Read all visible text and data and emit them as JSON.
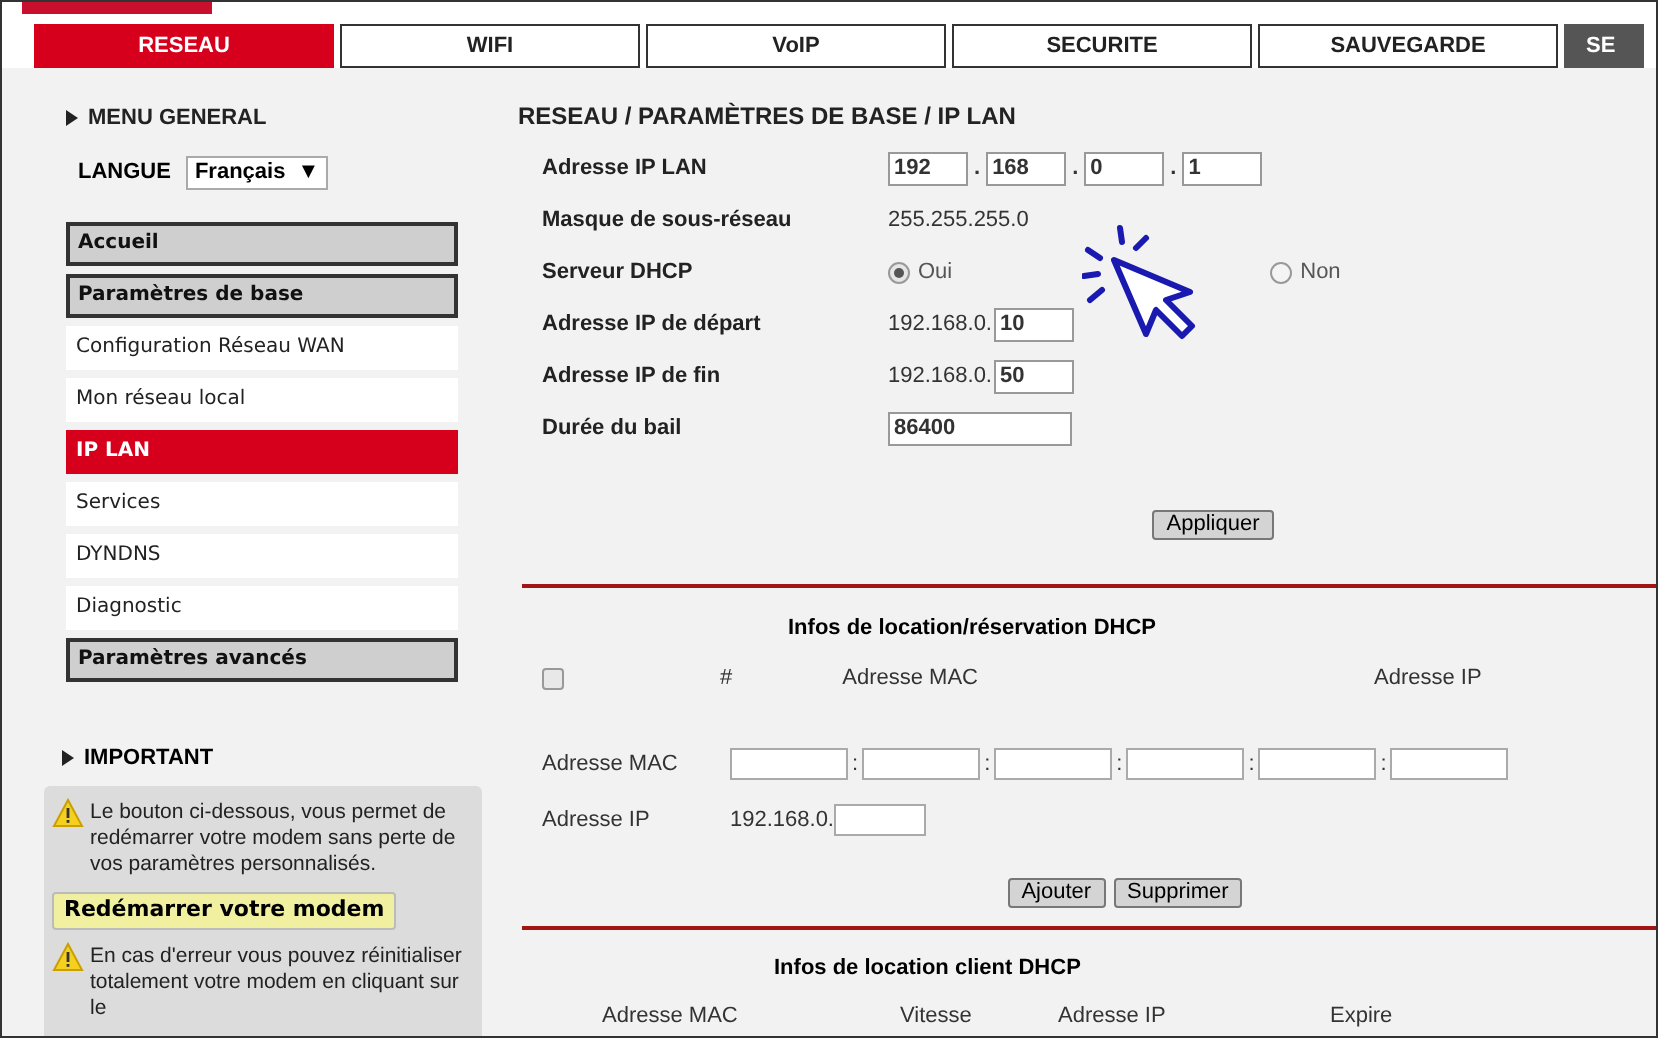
{
  "tabs": [
    {
      "label": "RESEAU",
      "selected": true
    },
    {
      "label": "WIFI",
      "selected": false
    },
    {
      "label": "VoIP",
      "selected": false
    },
    {
      "label": "SECURITE",
      "selected": false
    },
    {
      "label": "SAUVEGARDE",
      "selected": false
    },
    {
      "label": "SE",
      "selected": false
    }
  ],
  "sidebar": {
    "menu_title": "MENU GENERAL",
    "language_label": "LANGUE",
    "language_value": "Français",
    "language_caret": "▼",
    "items": [
      {
        "label": "Accueil",
        "kind": "section",
        "selected": false
      },
      {
        "label": "Paramètres de base",
        "kind": "section",
        "selected": false
      },
      {
        "label": "Configuration Réseau WAN",
        "kind": "link",
        "selected": false
      },
      {
        "label": "Mon réseau local",
        "kind": "link",
        "selected": false
      },
      {
        "label": "IP LAN",
        "kind": "link",
        "selected": true
      },
      {
        "label": "Services",
        "kind": "link",
        "selected": false
      },
      {
        "label": "DYNDNS",
        "kind": "link",
        "selected": false
      },
      {
        "label": "Diagnostic",
        "kind": "link",
        "selected": false
      },
      {
        "label": "Paramètres avancés",
        "kind": "section",
        "selected": false
      }
    ],
    "important_title": "IMPORTANT",
    "notices": [
      {
        "text": "Le bouton ci-dessous, vous permet de redémarrer votre modem sans perte de vos paramètres personnalisés.",
        "button": "Redémarrer votre modem"
      },
      {
        "text": "En cas d'erreur vous pouvez réinitialiser totalement votre modem en cliquant sur le"
      }
    ]
  },
  "content": {
    "breadcrumb": "RESEAU / PARAMÈTRES DE BASE / IP LAN",
    "fields": [
      {
        "label": "Adresse IP LAN",
        "kind": "ip4",
        "separator": ".",
        "values": [
          "192",
          "168",
          "0",
          "1"
        ]
      },
      {
        "label": "Masque de sous-réseau",
        "kind": "text",
        "value": "255.255.255.0"
      },
      {
        "label": "Serveur DHCP",
        "kind": "radio",
        "options": [
          {
            "label": "Oui",
            "selected": true
          },
          {
            "label": "Non",
            "selected": false
          }
        ]
      },
      {
        "label": "Adresse IP de départ",
        "kind": "prefixed",
        "prefix": "192.168.0.",
        "value": "10"
      },
      {
        "label": "Adresse IP de fin",
        "kind": "prefixed",
        "prefix": "192.168.0.",
        "value": "50"
      },
      {
        "label": "Durée du bail",
        "kind": "input",
        "value": "86400"
      }
    ],
    "apply_button": "Appliquer",
    "reservation": {
      "title": "Infos de location/réservation DHCP",
      "select_all_checked": false,
      "columns": [
        "#",
        "Adresse MAC",
        "Adresse IP"
      ],
      "mac_label": "Adresse MAC",
      "mac_separator": ":",
      "ip_label": "Adresse IP",
      "ip_prefix": "192.168.0.",
      "buttons": [
        "Ajouter",
        "Supprimer"
      ]
    },
    "clients": {
      "title": "Infos de location client DHCP",
      "columns": [
        "Adresse MAC",
        "Vitesse",
        "Adresse IP",
        "Expire"
      ]
    }
  }
}
